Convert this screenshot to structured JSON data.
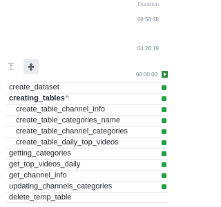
{
  "duration": {
    "header": "Duration",
    "values": [
      "08:56:38",
      "04:28:19",
      "00:00:00"
    ]
  },
  "toolbar": {
    "collapse_icon": "collapse-all-icon",
    "expand_icon": "expand-all-icon"
  },
  "status_color": "#22a046",
  "tasks": [
    {
      "label": "create_dataset",
      "status": "success"
    },
    {
      "label": "creating_tables",
      "status": "success",
      "expanded": true,
      "caret": "^"
    },
    {
      "label": "create_table_channel_info",
      "status": "success"
    },
    {
      "label": "create_table_categories_name",
      "status": "success"
    },
    {
      "label": "create_table_channel_categories",
      "status": "success"
    },
    {
      "label": "create_table_daily_top_videos",
      "status": "success"
    },
    {
      "label": "getting_categories",
      "status": "success"
    },
    {
      "label": "get_top_videos_daily",
      "status": "success"
    },
    {
      "label": "get_channel_info",
      "status": "success"
    },
    {
      "label": "updating_channels_categories",
      "status": "success"
    },
    {
      "label": "delete_temp_table",
      "status": "success"
    }
  ]
}
